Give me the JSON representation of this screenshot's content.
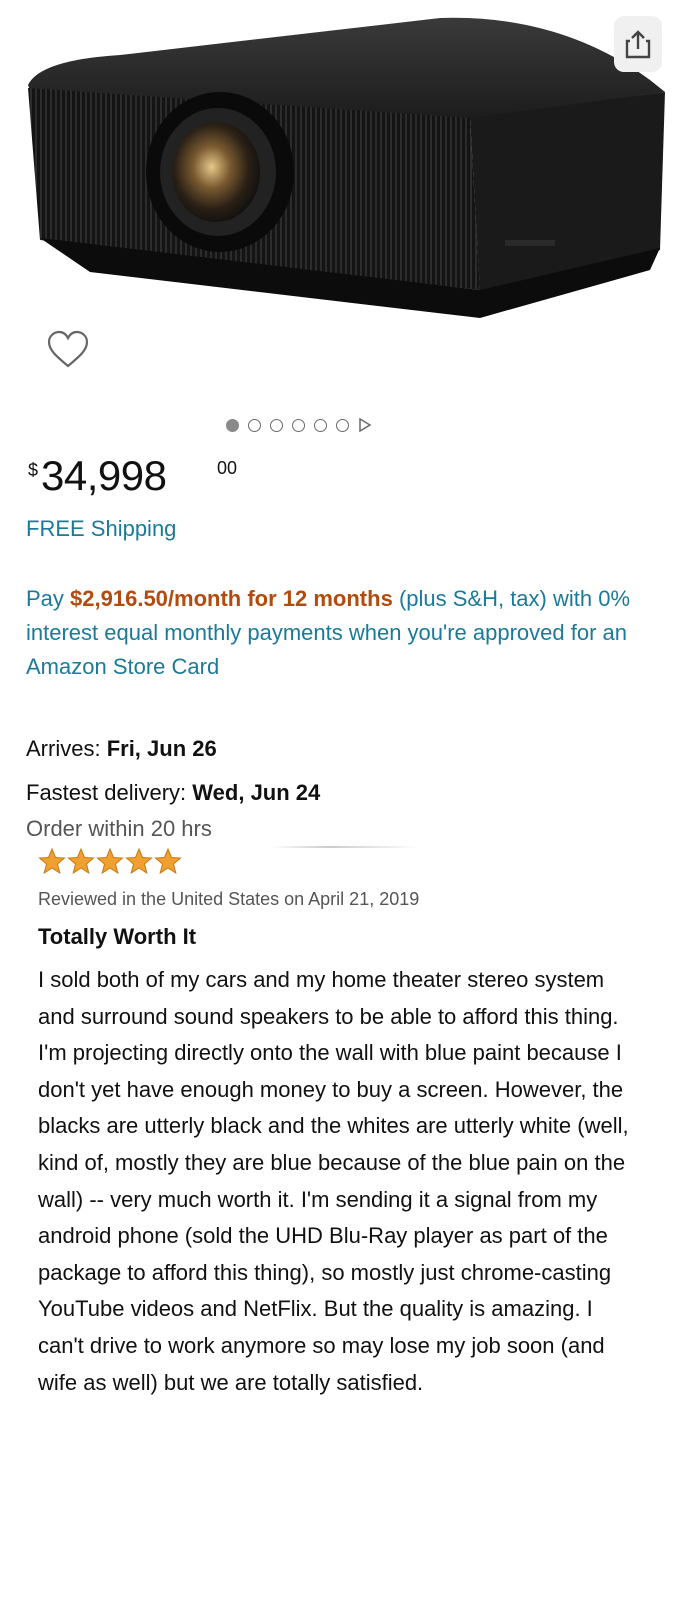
{
  "product": {
    "image_alt": "black projector",
    "share_icon": "share-icon",
    "wishlist_icon": "heart-icon",
    "carousel": {
      "total_dots": 6,
      "active_index": 0,
      "next_icon": "play-triangle-icon"
    }
  },
  "price": {
    "currency": "$",
    "whole": "34,998",
    "fraction": "00"
  },
  "shipping": {
    "label": "FREE Shipping"
  },
  "financing": {
    "prefix": "Pay",
    "highlight": "$2,916.50/month for 12 months",
    "suffix": "(plus S&H, tax) with 0% interest equal monthly payments when you're approved for an Amazon Store Card"
  },
  "delivery": {
    "arrives_label": "Arrives:",
    "arrives_date": "Fri, Jun 26",
    "fastest_label": "Fastest delivery:",
    "fastest_date": "Wed, Jun 24",
    "order_within": "Order within 20 hrs"
  },
  "review": {
    "rating": 5,
    "star_color": "#f0a030",
    "meta": "Reviewed in the United States on April 21, 2019",
    "title": "Totally Worth It",
    "body": "I sold both of my cars and my home theater stereo system and surround sound speakers to be able to afford this thing. I'm projecting directly onto the wall with blue paint because I don't yet have enough money to buy a screen. However, the blacks are utterly black and the whites are utterly white (well, kind of, mostly they are blue because of the blue pain on the wall) -- very much worth it. I'm sending it a signal from my android phone (sold the UHD Blu-Ray player as part of the package to afford this thing), so mostly just chrome-casting YouTube videos and NetFlix. But the quality is amazing. I can't drive to work anymore so may lose my job soon (and wife as well) but we are totally satisfied."
  },
  "colors": {
    "link": "#1b7a98",
    "price_highlight": "#b34b0f",
    "star": "#f0a030"
  }
}
